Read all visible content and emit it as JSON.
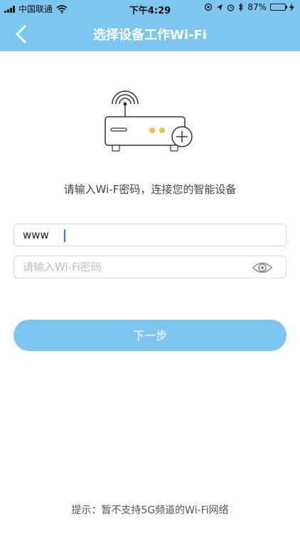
{
  "status_bar": {
    "carrier": "中国联通",
    "time": "下午4:29",
    "battery": "87%"
  },
  "nav": {
    "title": "选择设备工作Wi-Fi",
    "back_icon": "chevron-left-icon"
  },
  "illustration": {
    "icon": "router-add-icon"
  },
  "prompt": "请输入Wi-F密码，连接您的智能设备",
  "ssid_field": {
    "value": "www"
  },
  "password_field": {
    "placeholder": "请输入Wi-Fi密码",
    "eye_icon": "eye-icon"
  },
  "next_button": {
    "label": "下一步"
  },
  "tip": "提示：暂不支持5G频道的Wi-Fi网络",
  "colors": {
    "accent": "#7cc6ef",
    "text": "#444444",
    "placeholder": "#bdbdbd"
  }
}
